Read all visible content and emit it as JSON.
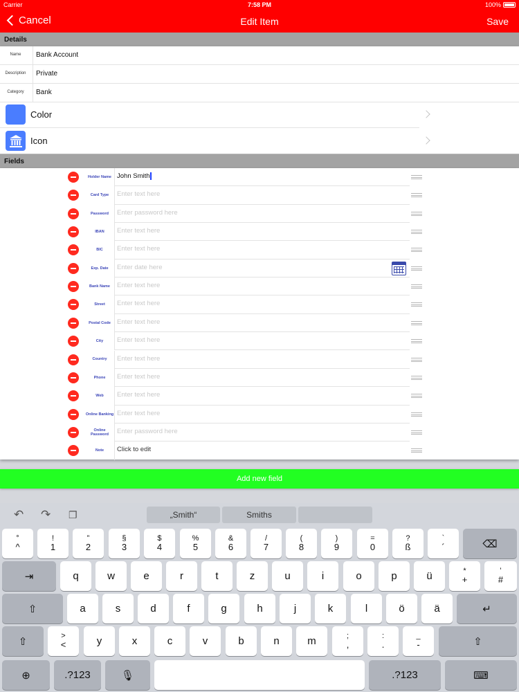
{
  "status_bar": {
    "carrier": "Carrier",
    "time": "7:58 PM",
    "battery": "100%"
  },
  "nav": {
    "cancel": "Cancel",
    "title": "Edit Item",
    "save": "Save"
  },
  "details": {
    "header": "Details",
    "rows": [
      {
        "label": "Name",
        "value": "Bank Account"
      },
      {
        "label": "Description",
        "value": "Private"
      },
      {
        "label": "Category",
        "value": "Bank"
      }
    ],
    "color_label": "Color",
    "icon_label": "Icon",
    "accent_color": "#4a7dff"
  },
  "fields": {
    "header": "Fields",
    "rows": [
      {
        "label": "Holder Name",
        "value": "John Smith",
        "placeholder": ""
      },
      {
        "label": "Card Type",
        "value": "",
        "placeholder": "Enter text here"
      },
      {
        "label": "Password",
        "value": "",
        "placeholder": "Enter password here"
      },
      {
        "label": "IBAN",
        "value": "",
        "placeholder": "Enter text here"
      },
      {
        "label": "BIC",
        "value": "",
        "placeholder": "Enter text here"
      },
      {
        "label": "Exp. Date",
        "value": "",
        "placeholder": "Enter date here"
      },
      {
        "label": "Bank Name",
        "value": "",
        "placeholder": "Enter text here"
      },
      {
        "label": "Street",
        "value": "",
        "placeholder": "Enter text here"
      },
      {
        "label": "Postal Code",
        "value": "",
        "placeholder": "Enter text here"
      },
      {
        "label": "City",
        "value": "",
        "placeholder": "Enter text here"
      },
      {
        "label": "Country",
        "value": "",
        "placeholder": "Enter text here"
      },
      {
        "label": "Phone",
        "value": "",
        "placeholder": "Enter text here"
      },
      {
        "label": "Web",
        "value": "",
        "placeholder": "Enter text here"
      },
      {
        "label": "Online Banking",
        "value": "",
        "placeholder": "Enter text here"
      },
      {
        "label": "Online Password",
        "value": "",
        "placeholder": "Enter password here"
      },
      {
        "label": "Note",
        "value": "Click to edit",
        "placeholder": ""
      }
    ]
  },
  "add_field": "Add new field",
  "keyboard": {
    "suggestions": [
      "„Smith“",
      "Smiths",
      ""
    ],
    "row1": [
      [
        "°",
        "^"
      ],
      [
        "!",
        "1"
      ],
      [
        "”",
        "2"
      ],
      [
        "§",
        "3"
      ],
      [
        "$",
        "4"
      ],
      [
        "%",
        "5"
      ],
      [
        "&",
        "6"
      ],
      [
        "/",
        "7"
      ],
      [
        "(",
        "8"
      ],
      [
        ")",
        "9"
      ],
      [
        "=",
        "0"
      ],
      [
        "?",
        "ß"
      ],
      [
        "`",
        "´"
      ]
    ],
    "row2": [
      "q",
      "w",
      "e",
      "r",
      "t",
      "z",
      "u",
      "i",
      "o",
      "p",
      "ü",
      [
        "*",
        "+"
      ],
      [
        "’",
        "#"
      ]
    ],
    "row3": [
      "a",
      "s",
      "d",
      "f",
      "g",
      "h",
      "j",
      "k",
      "l",
      "ö",
      "ä"
    ],
    "row4": [
      [
        ">",
        "<"
      ],
      "y",
      "x",
      "c",
      "v",
      "b",
      "n",
      "m",
      [
        ";",
        ","
      ],
      [
        ":",
        "."
      ],
      [
        "_",
        "-"
      ]
    ],
    "numbers_label": ".?123"
  },
  "colors": {
    "nav_bar": "#ff0000",
    "add_button": "#22ff22",
    "delete": "#ff2a1f",
    "label_text": "#3c46b8"
  }
}
